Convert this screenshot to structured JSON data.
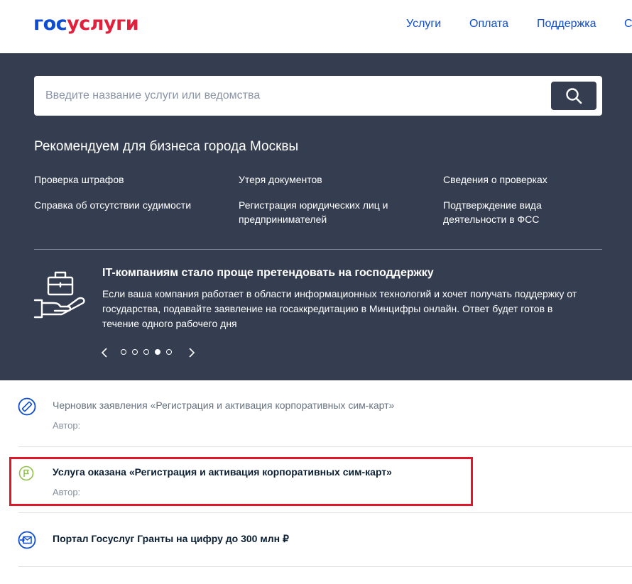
{
  "header": {
    "logo_part1": "гос",
    "logo_part2": "услуги",
    "nav": [
      "Услуги",
      "Оплата",
      "Поддержка",
      "С"
    ]
  },
  "search": {
    "placeholder": "Введите название услуги или ведомства"
  },
  "recommend": {
    "title": "Рекомендуем для бизнеса города Москвы",
    "links": [
      "Проверка штрафов",
      "Утеря документов",
      "Сведения о проверках",
      "Справка об отсутствии судимости",
      "Регистрация юридических лиц и предпринимателей",
      "Подтверждение вида деятельности в ФСС"
    ]
  },
  "promo": {
    "title": "IT-компаниям стало проще претендовать на господдержку",
    "text": "Если ваша компания работает в области информационных технологий и хочет получать поддержку от государства, подавайте заявление на госаккредитацию в Минцифры онлайн. Ответ будет готов в течение одного рабочего дня",
    "dots_total": 5,
    "active_dot": 4
  },
  "feed": [
    {
      "title": "Черновик заявления «Регистрация и активация корпоративных сим-карт»",
      "author": "Автор:",
      "icon": "draft-icon"
    },
    {
      "title": "Услуга оказана «Регистрация и активация корпоративных сим-карт»",
      "author": "Автор:",
      "icon": "flag-icon"
    },
    {
      "title": "Портал Госуслуг Гранты на цифру до 300 млн ₽",
      "icon": "mail-arrow-icon"
    }
  ],
  "colors": {
    "brand_blue": "#0d4cd3",
    "brand_red": "#e3203b",
    "hero_bg": "#353e51",
    "highlight": "#e0162b",
    "success_green": "#8fc14a"
  }
}
